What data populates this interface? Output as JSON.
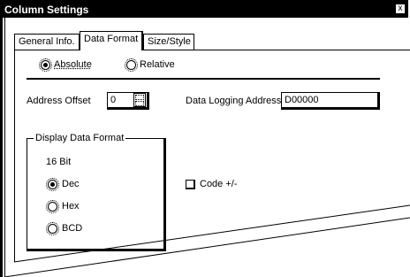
{
  "window": {
    "title": "Column Settings",
    "close_glyph": "x"
  },
  "tabs": [
    {
      "label": "General Info."
    },
    {
      "label": "Data Format"
    },
    {
      "label": "Size/Style"
    }
  ],
  "mode": {
    "absolute_label": "Absolute",
    "relative_label": "Relative",
    "selected": "Absolute"
  },
  "address_offset": {
    "label": "Address Offset",
    "value": "0"
  },
  "data_logging": {
    "label": "Data Logging Address",
    "value": "D00000"
  },
  "display_format": {
    "title": "Display Data Format",
    "bits": "16 Bit",
    "options": [
      "Dec",
      "Hex",
      "BCD"
    ],
    "selected": "Dec"
  },
  "code_sign": {
    "label": "Code +/-",
    "checked": false
  }
}
